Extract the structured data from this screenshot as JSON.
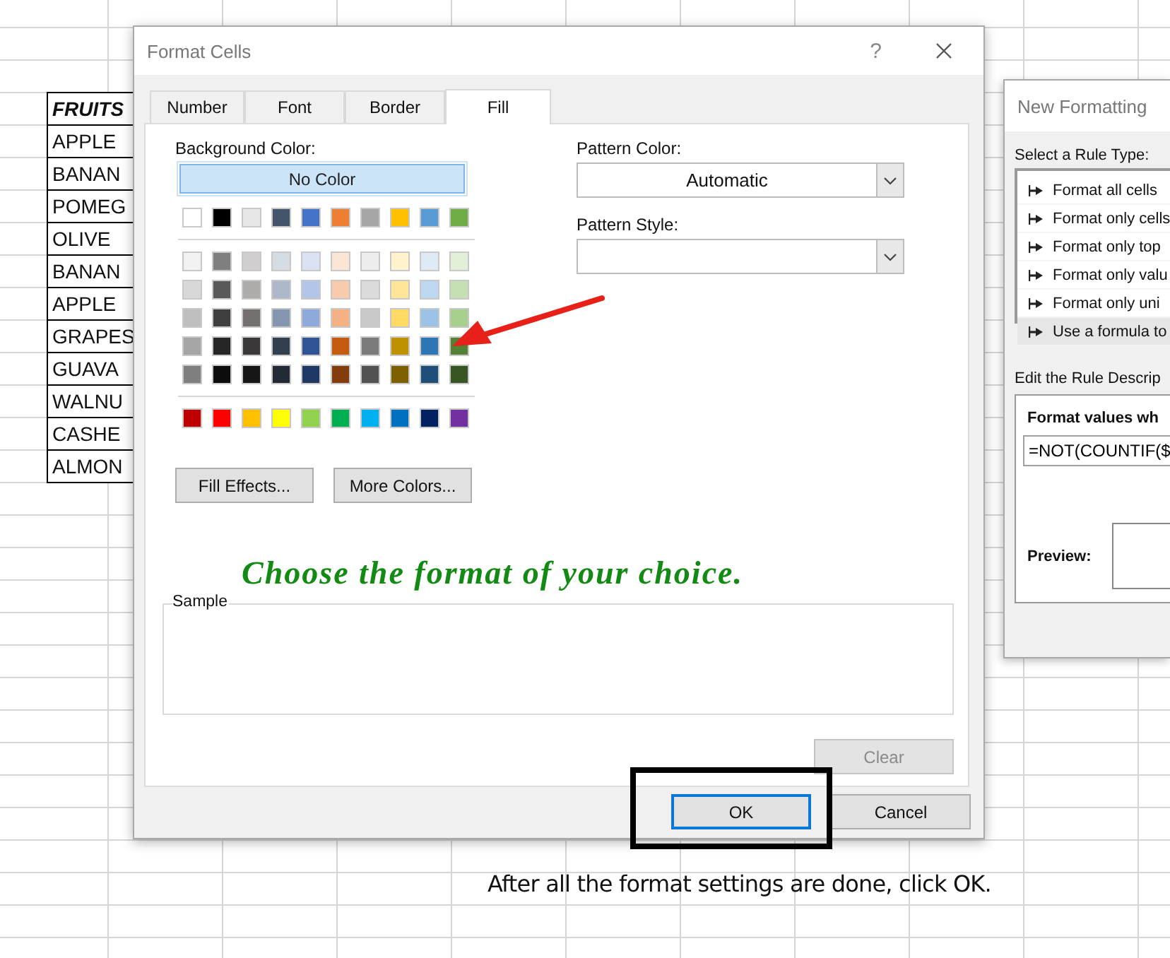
{
  "sheet": {
    "header": "FRUITS",
    "cells": [
      "APPLE",
      "BANAN",
      "POMEG",
      "OLIVE",
      "BANAN",
      "APPLE",
      "GRAPES",
      "GUAVA",
      "WALNU",
      "CASHE",
      "ALMON"
    ]
  },
  "format_cells": {
    "title": "Format Cells",
    "help": "?",
    "tabs": [
      {
        "label": "Number",
        "selected": false
      },
      {
        "label": "Font",
        "selected": false
      },
      {
        "label": "Border",
        "selected": false
      },
      {
        "label": "Fill",
        "selected": true
      }
    ],
    "background_color": {
      "label": "Background Color:",
      "no_color": "No Color",
      "palette_rows": [
        {
          "kind": "theme",
          "swatches": [
            {
              "color": "#ffffff"
            },
            {
              "color": "#000000"
            },
            {
              "color": "#e7e6e6"
            },
            {
              "color": "#44546a"
            },
            {
              "color": "#4472c4"
            },
            {
              "color": "#ed7d31"
            },
            {
              "color": "#a5a5a5"
            },
            {
              "color": "#ffc000"
            },
            {
              "color": "#5b9bd5"
            },
            {
              "color": "#70ad47"
            }
          ]
        },
        {
          "kind": "shade",
          "swatches": [
            {
              "color": "#f2f2f2"
            },
            {
              "color": "#7f7f7f"
            },
            {
              "color": "#d0cece"
            },
            {
              "color": "#d6dce4"
            },
            {
              "color": "#d9e2f3"
            },
            {
              "color": "#fbe5d5"
            },
            {
              "color": "#ededed"
            },
            {
              "color": "#fff2cc"
            },
            {
              "color": "#deebf6"
            },
            {
              "color": "#e2efd9"
            }
          ]
        },
        {
          "kind": "shade",
          "swatches": [
            {
              "color": "#d8d8d8"
            },
            {
              "color": "#595959"
            },
            {
              "color": "#aeabab"
            },
            {
              "color": "#adb9ca"
            },
            {
              "color": "#b4c6e7"
            },
            {
              "color": "#f7cbac"
            },
            {
              "color": "#dbdbdb"
            },
            {
              "color": "#fee599"
            },
            {
              "color": "#bdd7ee"
            },
            {
              "color": "#c5e0b3"
            }
          ]
        },
        {
          "kind": "shade",
          "swatches": [
            {
              "color": "#bfbfbf"
            },
            {
              "color": "#3f3f3f"
            },
            {
              "color": "#757070"
            },
            {
              "color": "#8496b0"
            },
            {
              "color": "#8eaadb"
            },
            {
              "color": "#f4b183"
            },
            {
              "color": "#c9c9c9"
            },
            {
              "color": "#ffd965"
            },
            {
              "color": "#9cc3e5"
            },
            {
              "color": "#a8d08d"
            }
          ]
        },
        {
          "kind": "shade",
          "swatches": [
            {
              "color": "#a5a5a5"
            },
            {
              "color": "#262626"
            },
            {
              "color": "#3a3838"
            },
            {
              "color": "#323f4f"
            },
            {
              "color": "#2f5496"
            },
            {
              "color": "#c55a11"
            },
            {
              "color": "#7b7b7b"
            },
            {
              "color": "#bf9000"
            },
            {
              "color": "#2e75b5"
            },
            {
              "color": "#538135"
            }
          ]
        },
        {
          "kind": "shade",
          "swatches": [
            {
              "color": "#7f7f7f"
            },
            {
              "color": "#0c0c0c"
            },
            {
              "color": "#171616"
            },
            {
              "color": "#222a35"
            },
            {
              "color": "#1f3864"
            },
            {
              "color": "#833c0b"
            },
            {
              "color": "#525252"
            },
            {
              "color": "#7f6000"
            },
            {
              "color": "#1e4e79"
            },
            {
              "color": "#375623"
            }
          ]
        },
        {
          "kind": "standard",
          "swatches": [
            {
              "color": "#c00000"
            },
            {
              "color": "#ff0000"
            },
            {
              "color": "#ffc000"
            },
            {
              "color": "#ffff00"
            },
            {
              "color": "#92d050"
            },
            {
              "color": "#00b050"
            },
            {
              "color": "#00b0f0"
            },
            {
              "color": "#0070c0"
            },
            {
              "color": "#002060"
            },
            {
              "color": "#7030a0"
            }
          ]
        }
      ]
    },
    "fill_effects": "Fill Effects...",
    "more_colors": "More Colors...",
    "pattern_color": {
      "label": "Pattern Color:",
      "value": "Automatic"
    },
    "pattern_style": {
      "label": "Pattern Style:"
    },
    "sample": {
      "label": "Sample"
    },
    "clear": {
      "label": "Clear",
      "disabled": true
    },
    "ok": {
      "label": "OK",
      "focused": true
    },
    "cancel": {
      "label": "Cancel",
      "focused": false
    }
  },
  "annotations": {
    "caption": "Choose the format of your choice.",
    "note": "After all the format settings are done, click OK."
  },
  "rule_dialog": {
    "title": "New Formatting",
    "rule_type_label": "Select a Rule Type:",
    "rule_types": [
      {
        "label": "Format all cells",
        "selected": false
      },
      {
        "label": "Format only cells",
        "selected": false
      },
      {
        "label": "Format only top",
        "selected": false
      },
      {
        "label": "Format only valu",
        "selected": false
      },
      {
        "label": "Format only uni",
        "selected": false
      },
      {
        "label": "Use a formula to",
        "selected": true
      }
    ],
    "description_label": "Edit the Rule Descrip",
    "condition_label": "Format values wh",
    "formula": "=NOT(COUNTIF($",
    "preview_label": "Preview:"
  }
}
